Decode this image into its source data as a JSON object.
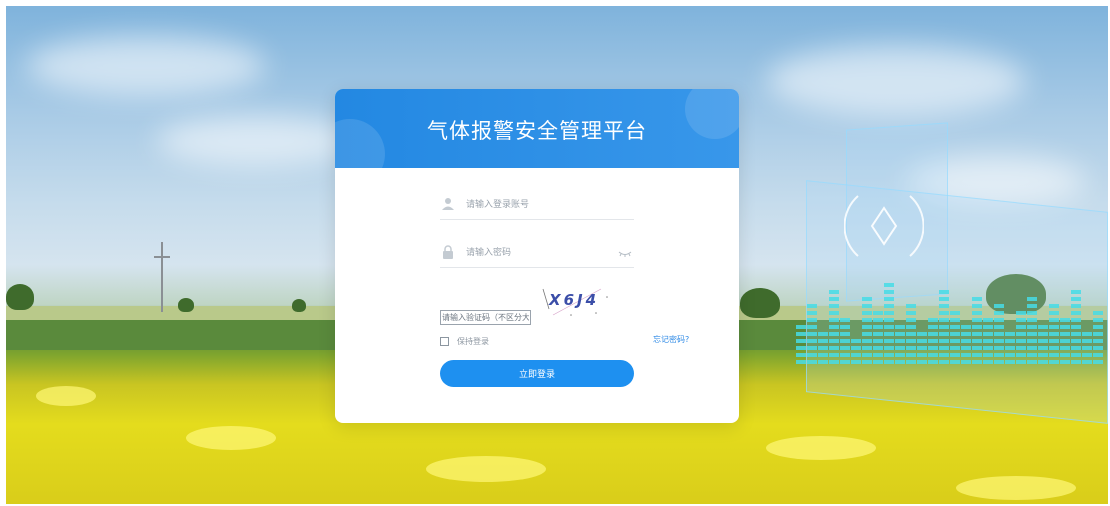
{
  "app": {
    "title": "气体报警安全管理平台"
  },
  "login": {
    "username_placeholder": "请输入登录账号",
    "password_placeholder": "请输入密码",
    "captcha_placeholder": "请输入验证码（不区分大小写）",
    "captcha_text": "X6J4",
    "remember_label": "保持登录",
    "forgot_label": "忘记密码?",
    "submit_label": "立即登录"
  },
  "icons": {
    "username": "user-icon",
    "password": "lock-icon",
    "visibility": "eye-closed-icon"
  },
  "colors": {
    "primary": "#1e90f0",
    "header": "#2388e2",
    "link": "#2e8ae6"
  }
}
